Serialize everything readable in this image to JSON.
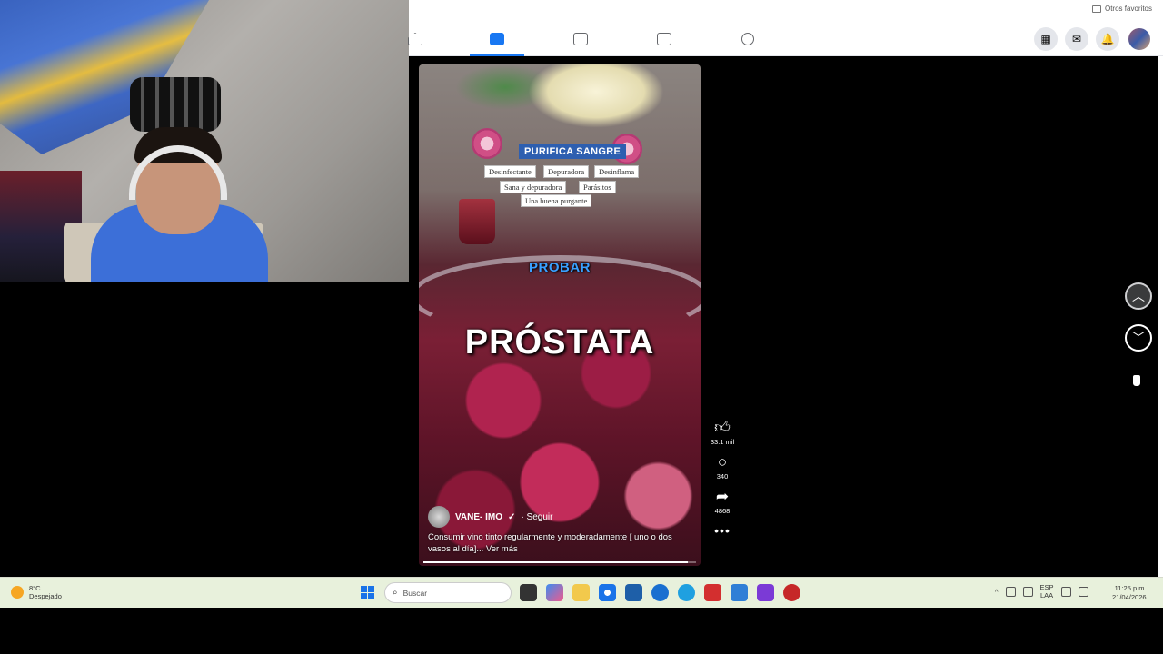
{
  "browser": {
    "favorites_label": "Otros favoritos"
  },
  "fb_nav": {
    "items": [
      {
        "name": "home",
        "icon": "home-icon"
      },
      {
        "name": "video",
        "icon": "video-icon",
        "active": true
      },
      {
        "name": "insights",
        "icon": "chart-icon"
      },
      {
        "name": "marketplace",
        "icon": "store-icon"
      },
      {
        "name": "gaming",
        "icon": "gaming-icon"
      }
    ],
    "right_icons": [
      "menu-grid-icon",
      "messenger-icon",
      "notifications-icon",
      "profile-avatar"
    ]
  },
  "reel": {
    "overlay_title": "PURIFICA SANGRE",
    "chips": [
      "Desinfectante",
      "Depuradora",
      "Desinflama",
      "Sana y depuradora",
      "Parásitos",
      "Una buena purgante"
    ],
    "subtitle": "PROBAR",
    "headline": "PRÓSTATA",
    "author": "VANE- IMO",
    "verified_mark": "✓",
    "follow": "· Seguir",
    "caption": "Consumir vino tinto regularmente y moderadamente [ uno o dos vasos al día]...",
    "see_more": "Ver más",
    "progress_fraction": 0.97
  },
  "actions": {
    "likes": "33.1 mil",
    "comments": "340",
    "shares": "4868"
  },
  "taskbar": {
    "weather_temp": "8°C",
    "weather_desc": "Despejado",
    "search_placeholder": "Buscar",
    "lang_top": "ESP",
    "lang_bottom": "LAA",
    "time": "11:25 p.m.",
    "date": "21/04/2026"
  },
  "colors": {
    "fb_blue": "#1877f2",
    "taskbar_bg": "#e8f1dc"
  }
}
